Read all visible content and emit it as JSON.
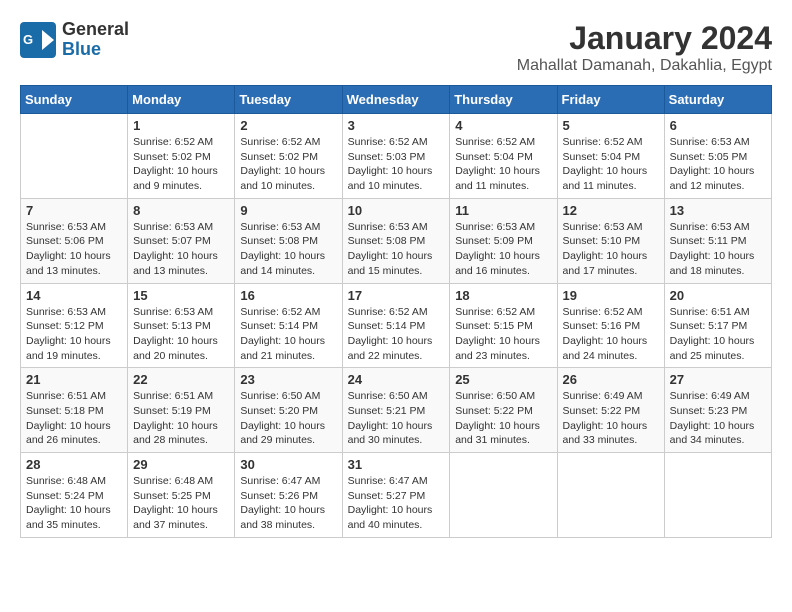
{
  "logo": {
    "general": "General",
    "blue": "Blue"
  },
  "title": "January 2024",
  "subtitle": "Mahallat Damanah, Dakahlia, Egypt",
  "days_of_week": [
    "Sunday",
    "Monday",
    "Tuesday",
    "Wednesday",
    "Thursday",
    "Friday",
    "Saturday"
  ],
  "weeks": [
    [
      {
        "day": "",
        "sunrise": "",
        "sunset": "",
        "daylight": ""
      },
      {
        "day": "1",
        "sunrise": "Sunrise: 6:52 AM",
        "sunset": "Sunset: 5:02 PM",
        "daylight": "Daylight: 10 hours and 9 minutes."
      },
      {
        "day": "2",
        "sunrise": "Sunrise: 6:52 AM",
        "sunset": "Sunset: 5:02 PM",
        "daylight": "Daylight: 10 hours and 10 minutes."
      },
      {
        "day": "3",
        "sunrise": "Sunrise: 6:52 AM",
        "sunset": "Sunset: 5:03 PM",
        "daylight": "Daylight: 10 hours and 10 minutes."
      },
      {
        "day": "4",
        "sunrise": "Sunrise: 6:52 AM",
        "sunset": "Sunset: 5:04 PM",
        "daylight": "Daylight: 10 hours and 11 minutes."
      },
      {
        "day": "5",
        "sunrise": "Sunrise: 6:52 AM",
        "sunset": "Sunset: 5:04 PM",
        "daylight": "Daylight: 10 hours and 11 minutes."
      },
      {
        "day": "6",
        "sunrise": "Sunrise: 6:53 AM",
        "sunset": "Sunset: 5:05 PM",
        "daylight": "Daylight: 10 hours and 12 minutes."
      }
    ],
    [
      {
        "day": "7",
        "sunrise": "Sunrise: 6:53 AM",
        "sunset": "Sunset: 5:06 PM",
        "daylight": "Daylight: 10 hours and 13 minutes."
      },
      {
        "day": "8",
        "sunrise": "Sunrise: 6:53 AM",
        "sunset": "Sunset: 5:07 PM",
        "daylight": "Daylight: 10 hours and 13 minutes."
      },
      {
        "day": "9",
        "sunrise": "Sunrise: 6:53 AM",
        "sunset": "Sunset: 5:08 PM",
        "daylight": "Daylight: 10 hours and 14 minutes."
      },
      {
        "day": "10",
        "sunrise": "Sunrise: 6:53 AM",
        "sunset": "Sunset: 5:08 PM",
        "daylight": "Daylight: 10 hours and 15 minutes."
      },
      {
        "day": "11",
        "sunrise": "Sunrise: 6:53 AM",
        "sunset": "Sunset: 5:09 PM",
        "daylight": "Daylight: 10 hours and 16 minutes."
      },
      {
        "day": "12",
        "sunrise": "Sunrise: 6:53 AM",
        "sunset": "Sunset: 5:10 PM",
        "daylight": "Daylight: 10 hours and 17 minutes."
      },
      {
        "day": "13",
        "sunrise": "Sunrise: 6:53 AM",
        "sunset": "Sunset: 5:11 PM",
        "daylight": "Daylight: 10 hours and 18 minutes."
      }
    ],
    [
      {
        "day": "14",
        "sunrise": "Sunrise: 6:53 AM",
        "sunset": "Sunset: 5:12 PM",
        "daylight": "Daylight: 10 hours and 19 minutes."
      },
      {
        "day": "15",
        "sunrise": "Sunrise: 6:53 AM",
        "sunset": "Sunset: 5:13 PM",
        "daylight": "Daylight: 10 hours and 20 minutes."
      },
      {
        "day": "16",
        "sunrise": "Sunrise: 6:52 AM",
        "sunset": "Sunset: 5:14 PM",
        "daylight": "Daylight: 10 hours and 21 minutes."
      },
      {
        "day": "17",
        "sunrise": "Sunrise: 6:52 AM",
        "sunset": "Sunset: 5:14 PM",
        "daylight": "Daylight: 10 hours and 22 minutes."
      },
      {
        "day": "18",
        "sunrise": "Sunrise: 6:52 AM",
        "sunset": "Sunset: 5:15 PM",
        "daylight": "Daylight: 10 hours and 23 minutes."
      },
      {
        "day": "19",
        "sunrise": "Sunrise: 6:52 AM",
        "sunset": "Sunset: 5:16 PM",
        "daylight": "Daylight: 10 hours and 24 minutes."
      },
      {
        "day": "20",
        "sunrise": "Sunrise: 6:51 AM",
        "sunset": "Sunset: 5:17 PM",
        "daylight": "Daylight: 10 hours and 25 minutes."
      }
    ],
    [
      {
        "day": "21",
        "sunrise": "Sunrise: 6:51 AM",
        "sunset": "Sunset: 5:18 PM",
        "daylight": "Daylight: 10 hours and 26 minutes."
      },
      {
        "day": "22",
        "sunrise": "Sunrise: 6:51 AM",
        "sunset": "Sunset: 5:19 PM",
        "daylight": "Daylight: 10 hours and 28 minutes."
      },
      {
        "day": "23",
        "sunrise": "Sunrise: 6:50 AM",
        "sunset": "Sunset: 5:20 PM",
        "daylight": "Daylight: 10 hours and 29 minutes."
      },
      {
        "day": "24",
        "sunrise": "Sunrise: 6:50 AM",
        "sunset": "Sunset: 5:21 PM",
        "daylight": "Daylight: 10 hours and 30 minutes."
      },
      {
        "day": "25",
        "sunrise": "Sunrise: 6:50 AM",
        "sunset": "Sunset: 5:22 PM",
        "daylight": "Daylight: 10 hours and 31 minutes."
      },
      {
        "day": "26",
        "sunrise": "Sunrise: 6:49 AM",
        "sunset": "Sunset: 5:22 PM",
        "daylight": "Daylight: 10 hours and 33 minutes."
      },
      {
        "day": "27",
        "sunrise": "Sunrise: 6:49 AM",
        "sunset": "Sunset: 5:23 PM",
        "daylight": "Daylight: 10 hours and 34 minutes."
      }
    ],
    [
      {
        "day": "28",
        "sunrise": "Sunrise: 6:48 AM",
        "sunset": "Sunset: 5:24 PM",
        "daylight": "Daylight: 10 hours and 35 minutes."
      },
      {
        "day": "29",
        "sunrise": "Sunrise: 6:48 AM",
        "sunset": "Sunset: 5:25 PM",
        "daylight": "Daylight: 10 hours and 37 minutes."
      },
      {
        "day": "30",
        "sunrise": "Sunrise: 6:47 AM",
        "sunset": "Sunset: 5:26 PM",
        "daylight": "Daylight: 10 hours and 38 minutes."
      },
      {
        "day": "31",
        "sunrise": "Sunrise: 6:47 AM",
        "sunset": "Sunset: 5:27 PM",
        "daylight": "Daylight: 10 hours and 40 minutes."
      },
      {
        "day": "",
        "sunrise": "",
        "sunset": "",
        "daylight": ""
      },
      {
        "day": "",
        "sunrise": "",
        "sunset": "",
        "daylight": ""
      },
      {
        "day": "",
        "sunrise": "",
        "sunset": "",
        "daylight": ""
      }
    ]
  ]
}
